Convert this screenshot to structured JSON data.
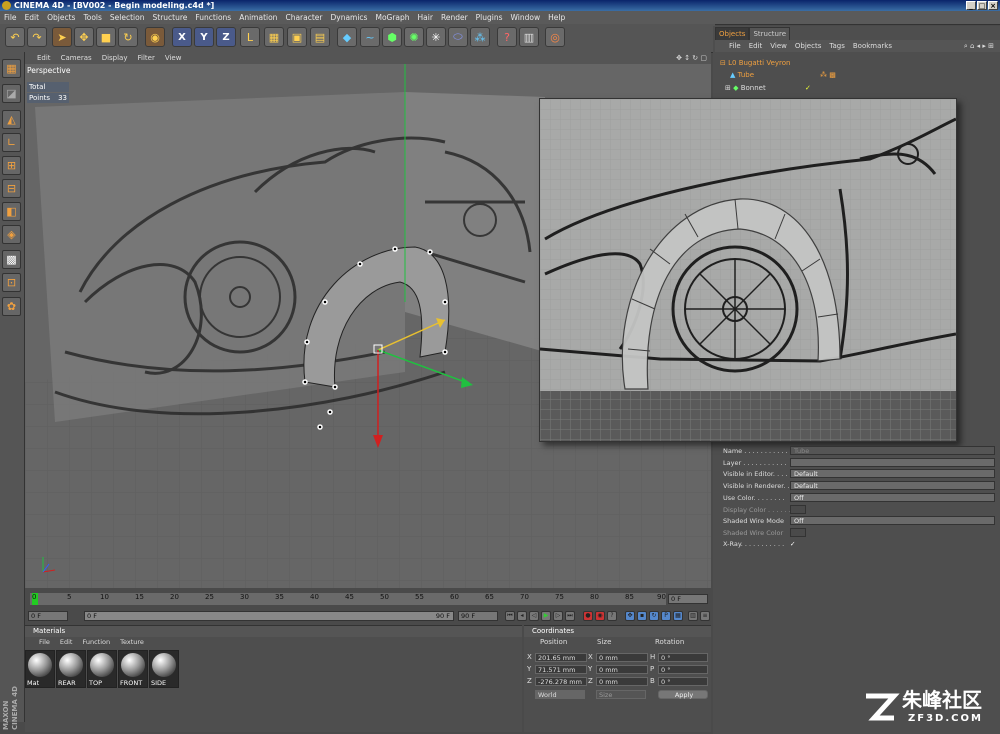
{
  "window": {
    "title": "CINEMA 4D - [BV002 - Begin modeling.c4d *]"
  },
  "menu": [
    "File",
    "Edit",
    "Objects",
    "Tools",
    "Selection",
    "Structure",
    "Functions",
    "Animation",
    "Character",
    "Dynamics",
    "MoGraph",
    "Hair",
    "Render",
    "Plugins",
    "Window",
    "Help"
  ],
  "toolbar": {
    "axes": [
      "X",
      "Y",
      "Z"
    ]
  },
  "viewport": {
    "menu": [
      "Edit",
      "Cameras",
      "Display",
      "Filter",
      "View"
    ],
    "label": "Perspective",
    "hud": [
      {
        "label": "Total",
        "value": ""
      },
      {
        "label": "Points",
        "value": "33"
      }
    ]
  },
  "object_manager": {
    "tabs": [
      "Objects",
      "Structure"
    ],
    "menu": [
      "File",
      "Edit",
      "View",
      "Objects",
      "Tags",
      "Bookmarks"
    ],
    "items": [
      "Bugatti Veyron",
      "Tube",
      "Bonnet"
    ]
  },
  "attributes": {
    "rows": [
      {
        "label": "Name . . . . . . . . . . .",
        "value": "Tube"
      },
      {
        "label": "Layer . . . . . . . . . . .",
        "value": ""
      },
      {
        "label": "Visible in Editor. . . . .",
        "value": "Default"
      },
      {
        "label": "Visible in Renderer. . .",
        "value": "Default"
      },
      {
        "label": "Use Color. . . . . . . .",
        "value": "Off"
      },
      {
        "label": "Display Color . . . . . .",
        "value": ""
      },
      {
        "label": "Shaded Wire Mode",
        "value": "Off"
      },
      {
        "label": "Shaded Wire Color",
        "value": ""
      },
      {
        "label": "X-Ray. . . . . . . . . . .",
        "value": "✓"
      }
    ]
  },
  "timeline": {
    "ticks": [
      "0",
      "5",
      "10",
      "15",
      "20",
      "25",
      "30",
      "35",
      "40",
      "45",
      "50",
      "55",
      "60",
      "65",
      "70",
      "75",
      "80",
      "85",
      "90"
    ],
    "current_frame": "0 F",
    "start": "0 F",
    "start2": "0 F",
    "end": "90 F",
    "end2": "90 F"
  },
  "materials": {
    "title": "Materials",
    "menu": [
      "File",
      "Edit",
      "Function",
      "Texture"
    ],
    "items": [
      "Mat",
      "REAR",
      "TOP",
      "FRONT",
      "SIDE"
    ]
  },
  "coordinates": {
    "title": "Coordinates",
    "headers": [
      "Position",
      "Size",
      "Rotation"
    ],
    "position": [
      {
        "axis": "X",
        "value": "201.65 mm"
      },
      {
        "axis": "Y",
        "value": "71.571 mm"
      },
      {
        "axis": "Z",
        "value": "-276.278 mm"
      }
    ],
    "size": [
      {
        "axis": "X",
        "value": "0 mm"
      },
      {
        "axis": "Y",
        "value": "0 mm"
      },
      {
        "axis": "Z",
        "value": "0 mm"
      }
    ],
    "rotation": [
      {
        "axis": "H",
        "value": "0 °"
      },
      {
        "axis": "P",
        "value": "0 °"
      },
      {
        "axis": "B",
        "value": "0 °"
      }
    ],
    "mode": "World",
    "size_mode": "Size",
    "apply": "Apply"
  },
  "branding": {
    "maxon": "MAXON CINEMA 4D",
    "watermark_cn": "朱峰社区",
    "watermark_url": "ZF3D.COM"
  }
}
